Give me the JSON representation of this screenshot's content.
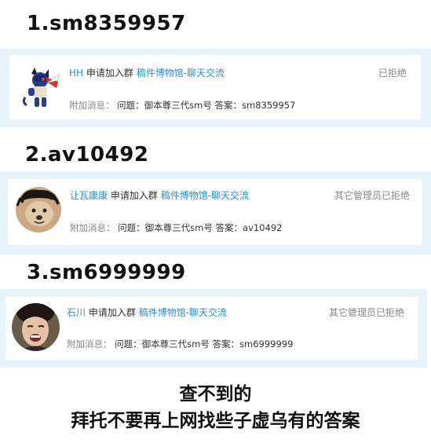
{
  "sections": [
    {
      "heading": "1.sm8359957",
      "request": {
        "user": "HH",
        "action": "申请加入群",
        "group": "稿件博物馆-聊天交流",
        "status": "已拒绝",
        "extra_label": "附加消息：",
        "question_label": "问题：",
        "question": "御本尊三代sm号",
        "answer_label": "答案：",
        "answer": "sm8359957"
      },
      "avatar_icon": "pokemon-avatar-icon"
    },
    {
      "heading": "2.av10492",
      "request": {
        "user": "让瓦康康",
        "action": "申请加入群",
        "group": "稿件博物馆-聊天交流",
        "status": "其它管理员已拒绝",
        "extra_label": "附加消息：",
        "question_label": "问题：",
        "question": "御本尊三代sm号",
        "answer_label": "答案：",
        "answer": "av10492"
      },
      "avatar_icon": "dog-avatar-icon"
    },
    {
      "heading": "3.sm6999999",
      "request": {
        "user": "石川",
        "action": "申请加入群",
        "group": "稿件博物馆-聊天交流",
        "status": "其它管理员已拒绝",
        "extra_label": "附加消息：",
        "question_label": "问题：",
        "question": "御本尊三代sm号",
        "answer_label": "答案：",
        "answer": "sm6999999"
      },
      "avatar_icon": "person-avatar-icon"
    }
  ],
  "caption": {
    "line1": "查不到的",
    "line2": "拜托不要再上网找些子虚乌有的答案"
  },
  "colors": {
    "panel_bg": "#e6f3fb",
    "link_blue": "#2a8fd0",
    "status_gray": "#888888"
  }
}
